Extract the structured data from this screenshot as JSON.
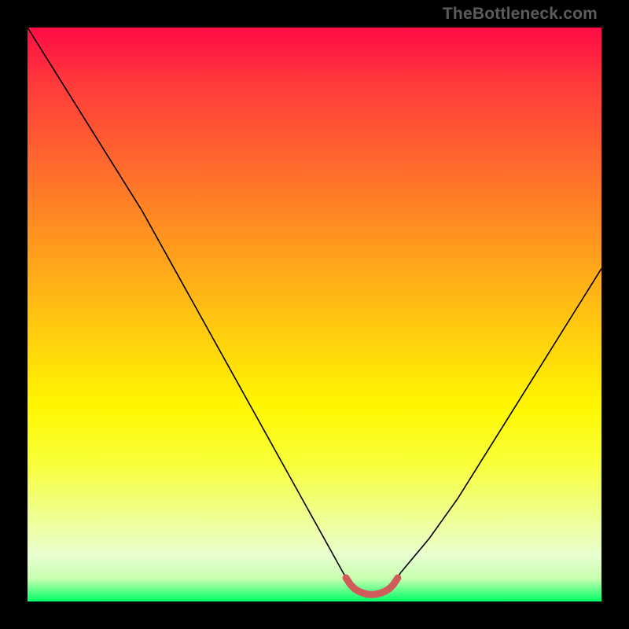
{
  "watermark": "TheBottleneck.com",
  "chart_data": {
    "type": "line",
    "title": "",
    "xlabel": "",
    "ylabel": "",
    "xlim": [
      0,
      100
    ],
    "ylim": [
      0,
      100
    ],
    "x": [
      0,
      5,
      10,
      15,
      20,
      25,
      30,
      35,
      40,
      45,
      50,
      55,
      56,
      57,
      58,
      59,
      60,
      61,
      62,
      63,
      64,
      65,
      70,
      75,
      80,
      85,
      90,
      95,
      100
    ],
    "values": [
      100,
      92,
      84,
      76,
      68,
      59,
      50,
      41,
      32,
      23,
      14,
      5,
      3.2,
      2.2,
      1.6,
      1.3,
      1.2,
      1.3,
      1.6,
      2.2,
      3.2,
      5,
      11,
      18,
      26,
      34,
      42,
      50,
      58
    ],
    "marker_region": {
      "x_start": 55.5,
      "x_end": 64.5,
      "y": 2.0
    },
    "marker_color": "#cf5b5b",
    "line_color": "#000000",
    "grid": false
  }
}
